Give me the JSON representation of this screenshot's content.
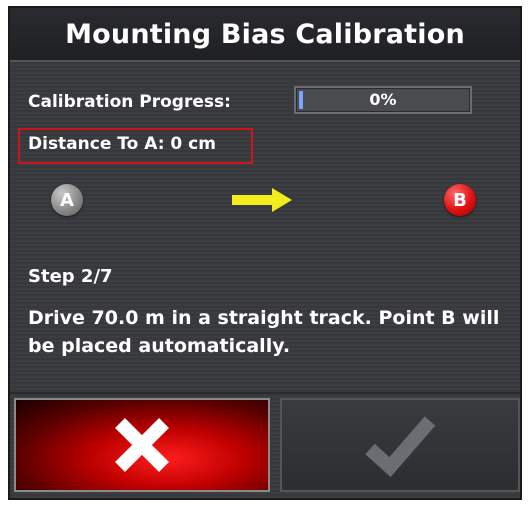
{
  "dialog": {
    "title": "Mounting Bias Calibration"
  },
  "progress": {
    "label": "Calibration Progress:",
    "value_text": "0%",
    "fraction": 0
  },
  "distance": {
    "label": "Distance To A: 0 cm"
  },
  "points": {
    "a_label": "A",
    "b_label": "B",
    "arrow_icon": "right-arrow-icon"
  },
  "step": {
    "label": "Step 2/7",
    "instruction": "Drive 70.0 m in a straight track. Point B will be placed automatically."
  },
  "buttons": {
    "cancel_icon": "close-icon",
    "confirm_icon": "checkmark-icon"
  },
  "colors": {
    "highlight_box": "#d0141a",
    "arrow": "#f3ee1a",
    "point_b": "#e01010",
    "cancel_bg": "#c00000"
  }
}
